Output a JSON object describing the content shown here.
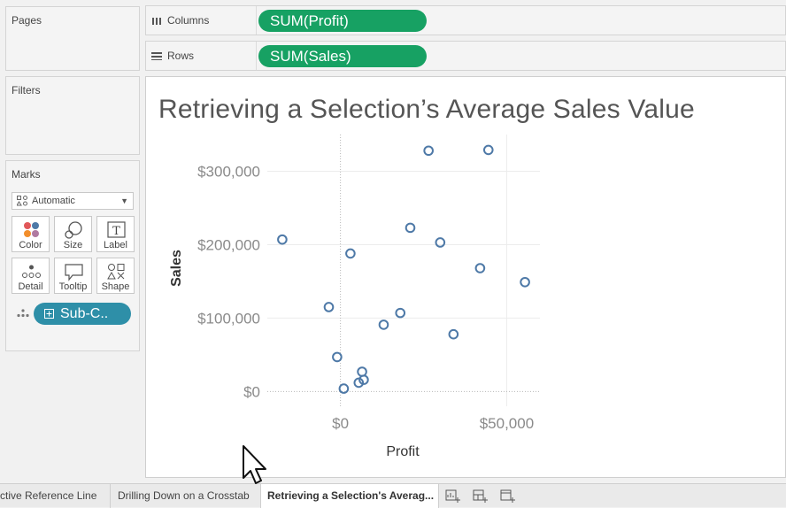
{
  "side": {
    "pages_title": "Pages",
    "filters_title": "Filters",
    "marks_title": "Marks",
    "mark_type": "Automatic",
    "buttons": [
      "Color",
      "Size",
      "Label",
      "Detail",
      "Tooltip",
      "Shape"
    ],
    "detail_pill": "Sub-C.."
  },
  "shelves": {
    "columns_label": "Columns",
    "columns_pill": "SUM(Profit)",
    "rows_label": "Rows",
    "rows_pill": "SUM(Sales)"
  },
  "viz": {
    "title": "Retrieving a Selection’s Average Sales Value"
  },
  "chart_data": {
    "type": "scatter",
    "title": "Retrieving a Selection’s Average Sales Value",
    "xlabel": "Profit",
    "ylabel": "Sales",
    "xlim": [
      -22000,
      60000
    ],
    "ylim": [
      -20000,
      350000
    ],
    "x_ticks": [
      0,
      50000
    ],
    "x_tick_labels": [
      "$0",
      "$50,000"
    ],
    "y_ticks": [
      0,
      100000,
      200000,
      300000
    ],
    "y_tick_labels": [
      "$0",
      "$100,000",
      "$200,000",
      "$300,000"
    ],
    "grid": true,
    "series": [
      {
        "x": [
          26500,
          44500,
          -17500,
          21000,
          30000,
          3000,
          42000,
          55500,
          -3500,
          18000,
          13000,
          34000,
          -1000,
          6500,
          1000,
          5500,
          7000
        ],
        "y": [
          328000,
          329000,
          207000,
          223000,
          203000,
          188000,
          168000,
          149000,
          115000,
          107000,
          91000,
          78000,
          47000,
          27000,
          4000,
          12000,
          16000
        ]
      }
    ],
    "marker_color": "#4e79a7"
  },
  "tabs": {
    "items": [
      "ctive Reference Line",
      "Drilling Down on a Crosstab",
      "Retrieving a Selection's Averag..."
    ]
  }
}
